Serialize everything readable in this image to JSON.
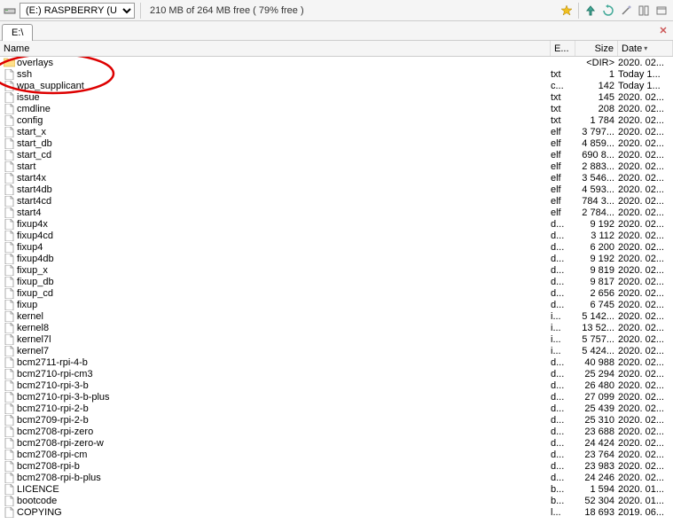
{
  "toolbar": {
    "drive_label": "(E:) RASPBERRY (U",
    "free_text": "210 MB of 264 MB free ( 79% free )"
  },
  "tab": {
    "path": "E:\\"
  },
  "headers": {
    "name": "Name",
    "ext": "E...",
    "size": "Size",
    "date": "Date"
  },
  "files": [
    {
      "icon": "folder",
      "name": "overlays",
      "ext": "",
      "size": "<DIR>",
      "date": "2020. 02..."
    },
    {
      "icon": "file",
      "name": "ssh",
      "ext": "txt",
      "size": "1",
      "date": "Today 1..."
    },
    {
      "icon": "file",
      "name": "wpa_supplicant",
      "ext": "c...",
      "size": "142",
      "date": "Today 1..."
    },
    {
      "icon": "file",
      "name": "issue",
      "ext": "txt",
      "size": "145",
      "date": "2020. 02..."
    },
    {
      "icon": "file",
      "name": "cmdline",
      "ext": "txt",
      "size": "208",
      "date": "2020. 02..."
    },
    {
      "icon": "file",
      "name": "config",
      "ext": "txt",
      "size": "1 784",
      "date": "2020. 02..."
    },
    {
      "icon": "file",
      "name": "start_x",
      "ext": "elf",
      "size": "3 797...",
      "date": "2020. 02..."
    },
    {
      "icon": "file",
      "name": "start_db",
      "ext": "elf",
      "size": "4 859...",
      "date": "2020. 02..."
    },
    {
      "icon": "file",
      "name": "start_cd",
      "ext": "elf",
      "size": "690 8...",
      "date": "2020. 02..."
    },
    {
      "icon": "file",
      "name": "start",
      "ext": "elf",
      "size": "2 883...",
      "date": "2020. 02..."
    },
    {
      "icon": "file",
      "name": "start4x",
      "ext": "elf",
      "size": "3 546...",
      "date": "2020. 02..."
    },
    {
      "icon": "file",
      "name": "start4db",
      "ext": "elf",
      "size": "4 593...",
      "date": "2020. 02..."
    },
    {
      "icon": "file",
      "name": "start4cd",
      "ext": "elf",
      "size": "784 3...",
      "date": "2020. 02..."
    },
    {
      "icon": "file",
      "name": "start4",
      "ext": "elf",
      "size": "2 784...",
      "date": "2020. 02..."
    },
    {
      "icon": "file",
      "name": "fixup4x",
      "ext": "d...",
      "size": "9 192",
      "date": "2020. 02..."
    },
    {
      "icon": "file",
      "name": "fixup4cd",
      "ext": "d...",
      "size": "3 112",
      "date": "2020. 02..."
    },
    {
      "icon": "file",
      "name": "fixup4",
      "ext": "d...",
      "size": "6 200",
      "date": "2020. 02..."
    },
    {
      "icon": "file",
      "name": "fixup4db",
      "ext": "d...",
      "size": "9 192",
      "date": "2020. 02..."
    },
    {
      "icon": "file",
      "name": "fixup_x",
      "ext": "d...",
      "size": "9 819",
      "date": "2020. 02..."
    },
    {
      "icon": "file",
      "name": "fixup_db",
      "ext": "d...",
      "size": "9 817",
      "date": "2020. 02..."
    },
    {
      "icon": "file",
      "name": "fixup_cd",
      "ext": "d...",
      "size": "2 656",
      "date": "2020. 02..."
    },
    {
      "icon": "file",
      "name": "fixup",
      "ext": "d...",
      "size": "6 745",
      "date": "2020. 02..."
    },
    {
      "icon": "file",
      "name": "kernel",
      "ext": "i...",
      "size": "5 142...",
      "date": "2020. 02..."
    },
    {
      "icon": "file",
      "name": "kernel8",
      "ext": "i...",
      "size": "13 52...",
      "date": "2020. 02..."
    },
    {
      "icon": "file",
      "name": "kernel7l",
      "ext": "i...",
      "size": "5 757...",
      "date": "2020. 02..."
    },
    {
      "icon": "file",
      "name": "kernel7",
      "ext": "i...",
      "size": "5 424...",
      "date": "2020. 02..."
    },
    {
      "icon": "file",
      "name": "bcm2711-rpi-4-b",
      "ext": "d...",
      "size": "40 988",
      "date": "2020. 02..."
    },
    {
      "icon": "file",
      "name": "bcm2710-rpi-cm3",
      "ext": "d...",
      "size": "25 294",
      "date": "2020. 02..."
    },
    {
      "icon": "file",
      "name": "bcm2710-rpi-3-b",
      "ext": "d...",
      "size": "26 480",
      "date": "2020. 02..."
    },
    {
      "icon": "file",
      "name": "bcm2710-rpi-3-b-plus",
      "ext": "d...",
      "size": "27 099",
      "date": "2020. 02..."
    },
    {
      "icon": "file",
      "name": "bcm2710-rpi-2-b",
      "ext": "d...",
      "size": "25 439",
      "date": "2020. 02..."
    },
    {
      "icon": "file",
      "name": "bcm2709-rpi-2-b",
      "ext": "d...",
      "size": "25 310",
      "date": "2020. 02..."
    },
    {
      "icon": "file",
      "name": "bcm2708-rpi-zero",
      "ext": "d...",
      "size": "23 688",
      "date": "2020. 02..."
    },
    {
      "icon": "file",
      "name": "bcm2708-rpi-zero-w",
      "ext": "d...",
      "size": "24 424",
      "date": "2020. 02..."
    },
    {
      "icon": "file",
      "name": "bcm2708-rpi-cm",
      "ext": "d...",
      "size": "23 764",
      "date": "2020. 02..."
    },
    {
      "icon": "file",
      "name": "bcm2708-rpi-b",
      "ext": "d...",
      "size": "23 983",
      "date": "2020. 02..."
    },
    {
      "icon": "file",
      "name": "bcm2708-rpi-b-plus",
      "ext": "d...",
      "size": "24 246",
      "date": "2020. 02..."
    },
    {
      "icon": "file",
      "name": "LICENCE",
      "ext": "b...",
      "size": "1 594",
      "date": "2020. 01..."
    },
    {
      "icon": "file",
      "name": "bootcode",
      "ext": "b...",
      "size": "52 304",
      "date": "2020. 01..."
    },
    {
      "icon": "file",
      "name": "COPYING",
      "ext": "l...",
      "size": "18 693",
      "date": "2019. 06..."
    }
  ]
}
